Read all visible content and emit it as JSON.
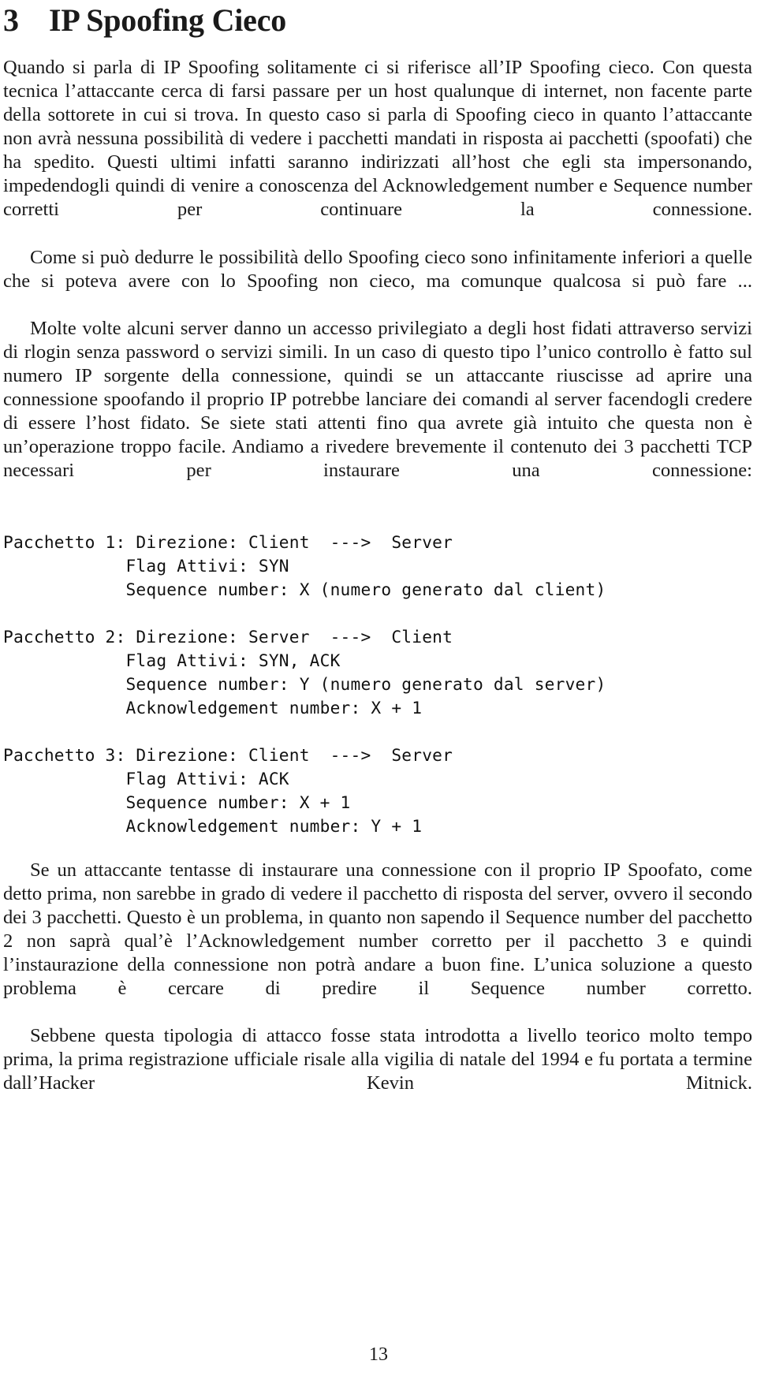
{
  "document": {
    "section": {
      "number": "3",
      "title": "IP Spoofing Cieco"
    },
    "paragraphs": [
      "Quando si parla di IP Spoofing solitamente ci si riferisce all’IP Spoofing cieco. Con questa tecnica l’attaccante cerca di farsi passare per un host qualunque di internet, non facente parte della sottorete in cui si trova. In questo caso si parla di Spoofing cieco in quanto l’attaccante non avrà nessuna possibilità di vedere i pacchetti mandati in risposta ai pacchetti (spoofati) che ha spedito. Questi ultimi infatti saranno indirizzati all’host che egli sta impersonando, impedendogli quindi di venire a conoscenza del Acknowledgement number e Sequence number corretti per continuare la connessione.",
      "Come si può dedurre le possibilità dello Spoofing cieco sono infinitamente inferiori a quelle che si poteva avere con lo Spoofing non cieco, ma comunque qualcosa si può fare ...",
      "Molte volte alcuni server danno un accesso privilegiato a degli host fidati attraverso servizi di rlogin senza password o servizi simili. In un caso di questo tipo l’unico controllo è fatto sul numero IP sorgente della connessione, quindi se un attaccante riuscisse ad aprire una connessione spoofando il proprio IP potrebbe lanciare dei comandi al server facendogli credere di essere l’host fidato. Se siete stati attenti fino qua avrete già intuito che questa non è un’operazione troppo facile. Andiamo a rivedere brevemente il contenuto dei 3 pacchetti TCP necessari per instaurare una connessione:"
    ],
    "code_blocks": [
      {
        "name": "pacchetto-1",
        "lines": [
          "Pacchetto 1: Direzione: Client  --->  Server",
          "            Flag Attivi: SYN",
          "            Sequence number: X (numero generato dal client)"
        ]
      },
      {
        "name": "pacchetto-2",
        "lines": [
          "Pacchetto 2: Direzione: Server  --->  Client",
          "            Flag Attivi: SYN, ACK",
          "            Sequence number: Y (numero generato dal server)",
          "            Acknowledgement number: X + 1"
        ]
      },
      {
        "name": "pacchetto-3",
        "lines": [
          "Pacchetto 3: Direzione: Client  --->  Server",
          "            Flag Attivi: ACK",
          "            Sequence number: X + 1",
          "            Acknowledgement number: Y + 1"
        ]
      }
    ],
    "tail_paragraphs": [
      "Se un attaccante tentasse di instaurare una connessione con il proprio IP Spoofato, come detto prima, non sarebbe in grado di vedere il pacchetto di risposta del server, ovvero il secondo dei 3 pacchetti. Questo è un problema, in quanto non sapendo il Sequence number del pacchetto 2 non saprà qual’è l’Acknowledgement number corretto per il pacchetto 3 e quindi l’instaurazione della connessione non potrà andare a buon fine. L’unica soluzione a questo problema è cercare di predire il Sequence number corretto.",
      "Sebbene questa tipologia di attacco fosse stata introdotta a livello teorico molto tempo prima, la prima registrazione ufficiale risale alla vigilia di natale del 1994 e fu portata a termine dall’Hacker Kevin Mitnick."
    ],
    "page_number": "13"
  }
}
